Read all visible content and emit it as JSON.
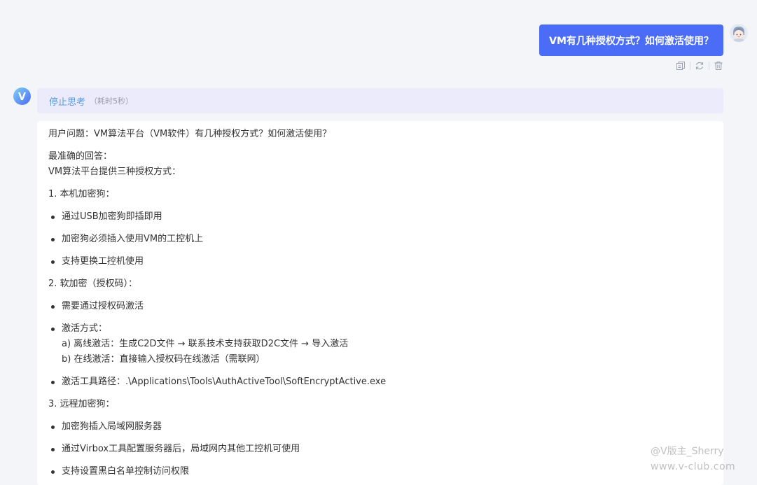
{
  "user_message": {
    "text": "VM有几种授权方式？如何激活使用？"
  },
  "message_actions": [
    {
      "icon": "copy-icon"
    },
    {
      "icon": "refresh-icon"
    },
    {
      "icon": "trash-icon"
    }
  ],
  "thinking": {
    "stop_label": "停止思考",
    "elapsed": "（耗时5秒）"
  },
  "answer": {
    "question": "用户问题：VM算法平台（VM软件）有几种授权方式？如何激活使用？",
    "intro_label": "最准确的回答：",
    "intro": "VM算法平台提供三种授权方式：",
    "sections": [
      {
        "heading": "1. 本机加密狗：",
        "items": [
          [
            "通过USB加密狗即插即用"
          ],
          [
            "加密狗必须插入使用VM的工控机上"
          ],
          [
            "支持更换工控机使用"
          ]
        ]
      },
      {
        "heading": "2. 软加密（授权码）：",
        "items": [
          [
            "需要通过授权码激活"
          ],
          [
            "激活方式：",
            "a) 离线激活：生成C2D文件 → 联系技术支持获取D2C文件 → 导入激活",
            "b) 在线激活：直接输入授权码在线激活（需联网）"
          ],
          [
            "激活工具路径：.\\Applications\\Tools\\AuthActiveTool\\SoftEncryptActive.exe"
          ]
        ]
      },
      {
        "heading": "3. 远程加密狗：",
        "items": [
          [
            "加密狗插入局域网服务器"
          ],
          [
            "通过Virbox工具配置服务器后，局域网内其他工控机可使用"
          ],
          [
            "支持设置黑白名单控制访问权限"
          ]
        ]
      }
    ]
  },
  "watermark": {
    "line1": "@V版主_Sherry",
    "line2": "www.v-club.com"
  },
  "colors": {
    "accent": "#4a6cf7",
    "thinking_bg": "#ecebfb",
    "stop_text": "#5a9bd8"
  }
}
